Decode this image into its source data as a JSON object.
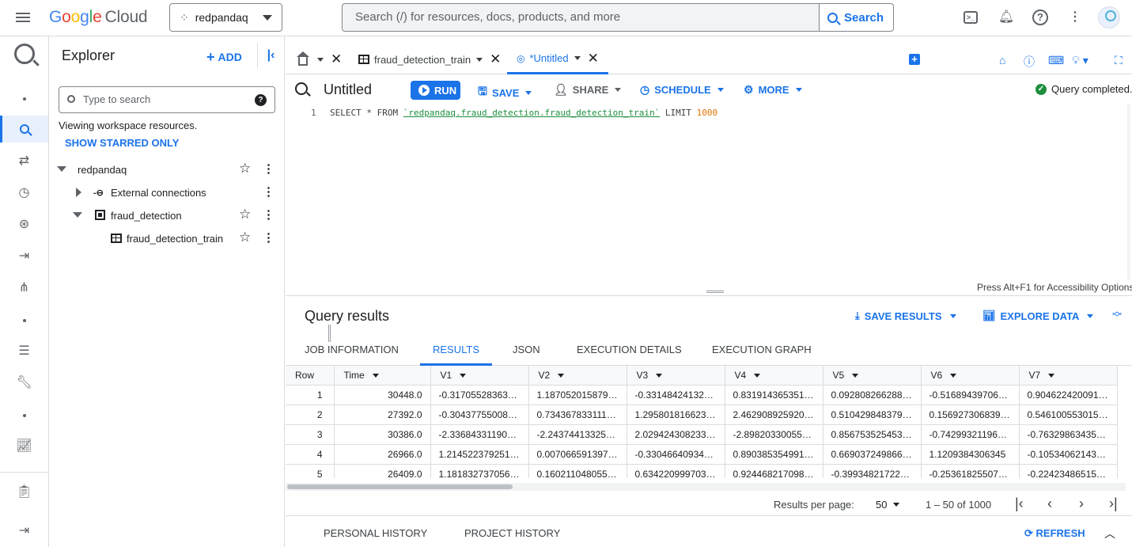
{
  "topbar": {
    "logo_letters": [
      "G",
      "o",
      "o",
      "g",
      "l",
      "e"
    ],
    "logo_cloud": "Cloud",
    "project": "redpandaq",
    "search_placeholder": "Search (/) for resources, docs, products, and more",
    "search_button": "Search"
  },
  "explorer": {
    "title": "Explorer",
    "add_label": "ADD",
    "search_placeholder": "Type to search",
    "workspace_note": "Viewing workspace resources.",
    "show_starred": "SHOW STARRED ONLY",
    "tree": {
      "project": "redpandaq",
      "external": "External connections",
      "dataset": "fraud_detection",
      "table": "fraud_detection_train"
    }
  },
  "tabs": {
    "table_tab": "fraud_detection_train",
    "query_tab": "*Untitled"
  },
  "toolbar": {
    "title": "Untitled",
    "run": "RUN",
    "save": "SAVE",
    "share": "SHARE",
    "schedule": "SCHEDULE",
    "more": "MORE",
    "status": "Query completed."
  },
  "editor": {
    "line_number": "1",
    "select": "SELECT * FROM",
    "table_ref": "`redpandaq.fraud_detection.fraud_detection_train`",
    "limit": "LIMIT",
    "limit_value": "1000",
    "accessibility": "Press Alt+F1 for Accessibility Options"
  },
  "results": {
    "title": "Query results",
    "save_results": "SAVE RESULTS",
    "explore_data": "EXPLORE DATA",
    "tabs": [
      "JOB INFORMATION",
      "RESULTS",
      "JSON",
      "EXECUTION DETAILS",
      "EXECUTION GRAPH"
    ],
    "columns": [
      "Row",
      "Time",
      "V1",
      "V2",
      "V3",
      "V4",
      "V5",
      "V6",
      "V7"
    ],
    "rows": [
      [
        "1",
        "30448.0",
        "-0.31705528363…",
        "1.187052015879…",
        "-0.33148424132…",
        "0.831914365351…",
        "0.092808266288…",
        "-0.51689439706…",
        "0.904622420091…"
      ],
      [
        "2",
        "27392.0",
        "-0.30437755008…",
        "0.734367833111…",
        "1.295801816623…",
        "2.462908925920…",
        "0.510429848379…",
        "0.156927306839…",
        "0.546100553015…"
      ],
      [
        "3",
        "30386.0",
        "-2.33684331190…",
        "-2.24374413325…",
        "2.029424308233…",
        "-2.89820330055…",
        "0.856753525453…",
        "-0.74299321196…",
        "-0.76329863435…"
      ],
      [
        "4",
        "26966.0",
        "1.214522379251…",
        "0.007066591397…",
        "-0.33046640934…",
        "0.890385354991…",
        "0.669037249866…",
        "1.1209384306345",
        "-0.10534062143…"
      ],
      [
        "5",
        "26409.0",
        "1.181832737056…",
        "0.160211048055…",
        "0.634220999703…",
        "0.924468217098…",
        "-0.39934821722…",
        "-0.25361825507…",
        "-0.22423486515…"
      ]
    ],
    "per_page_label": "Results per page:",
    "per_page": "50",
    "range": "1 – 50 of 1000",
    "personal_history": "PERSONAL HISTORY",
    "project_history": "PROJECT HISTORY",
    "refresh": "REFRESH"
  },
  "colors": {
    "accent": "#1a73e8",
    "success": "#1e8e3e",
    "string_literal": "#1e8e3e",
    "number_literal": "#e37400"
  }
}
